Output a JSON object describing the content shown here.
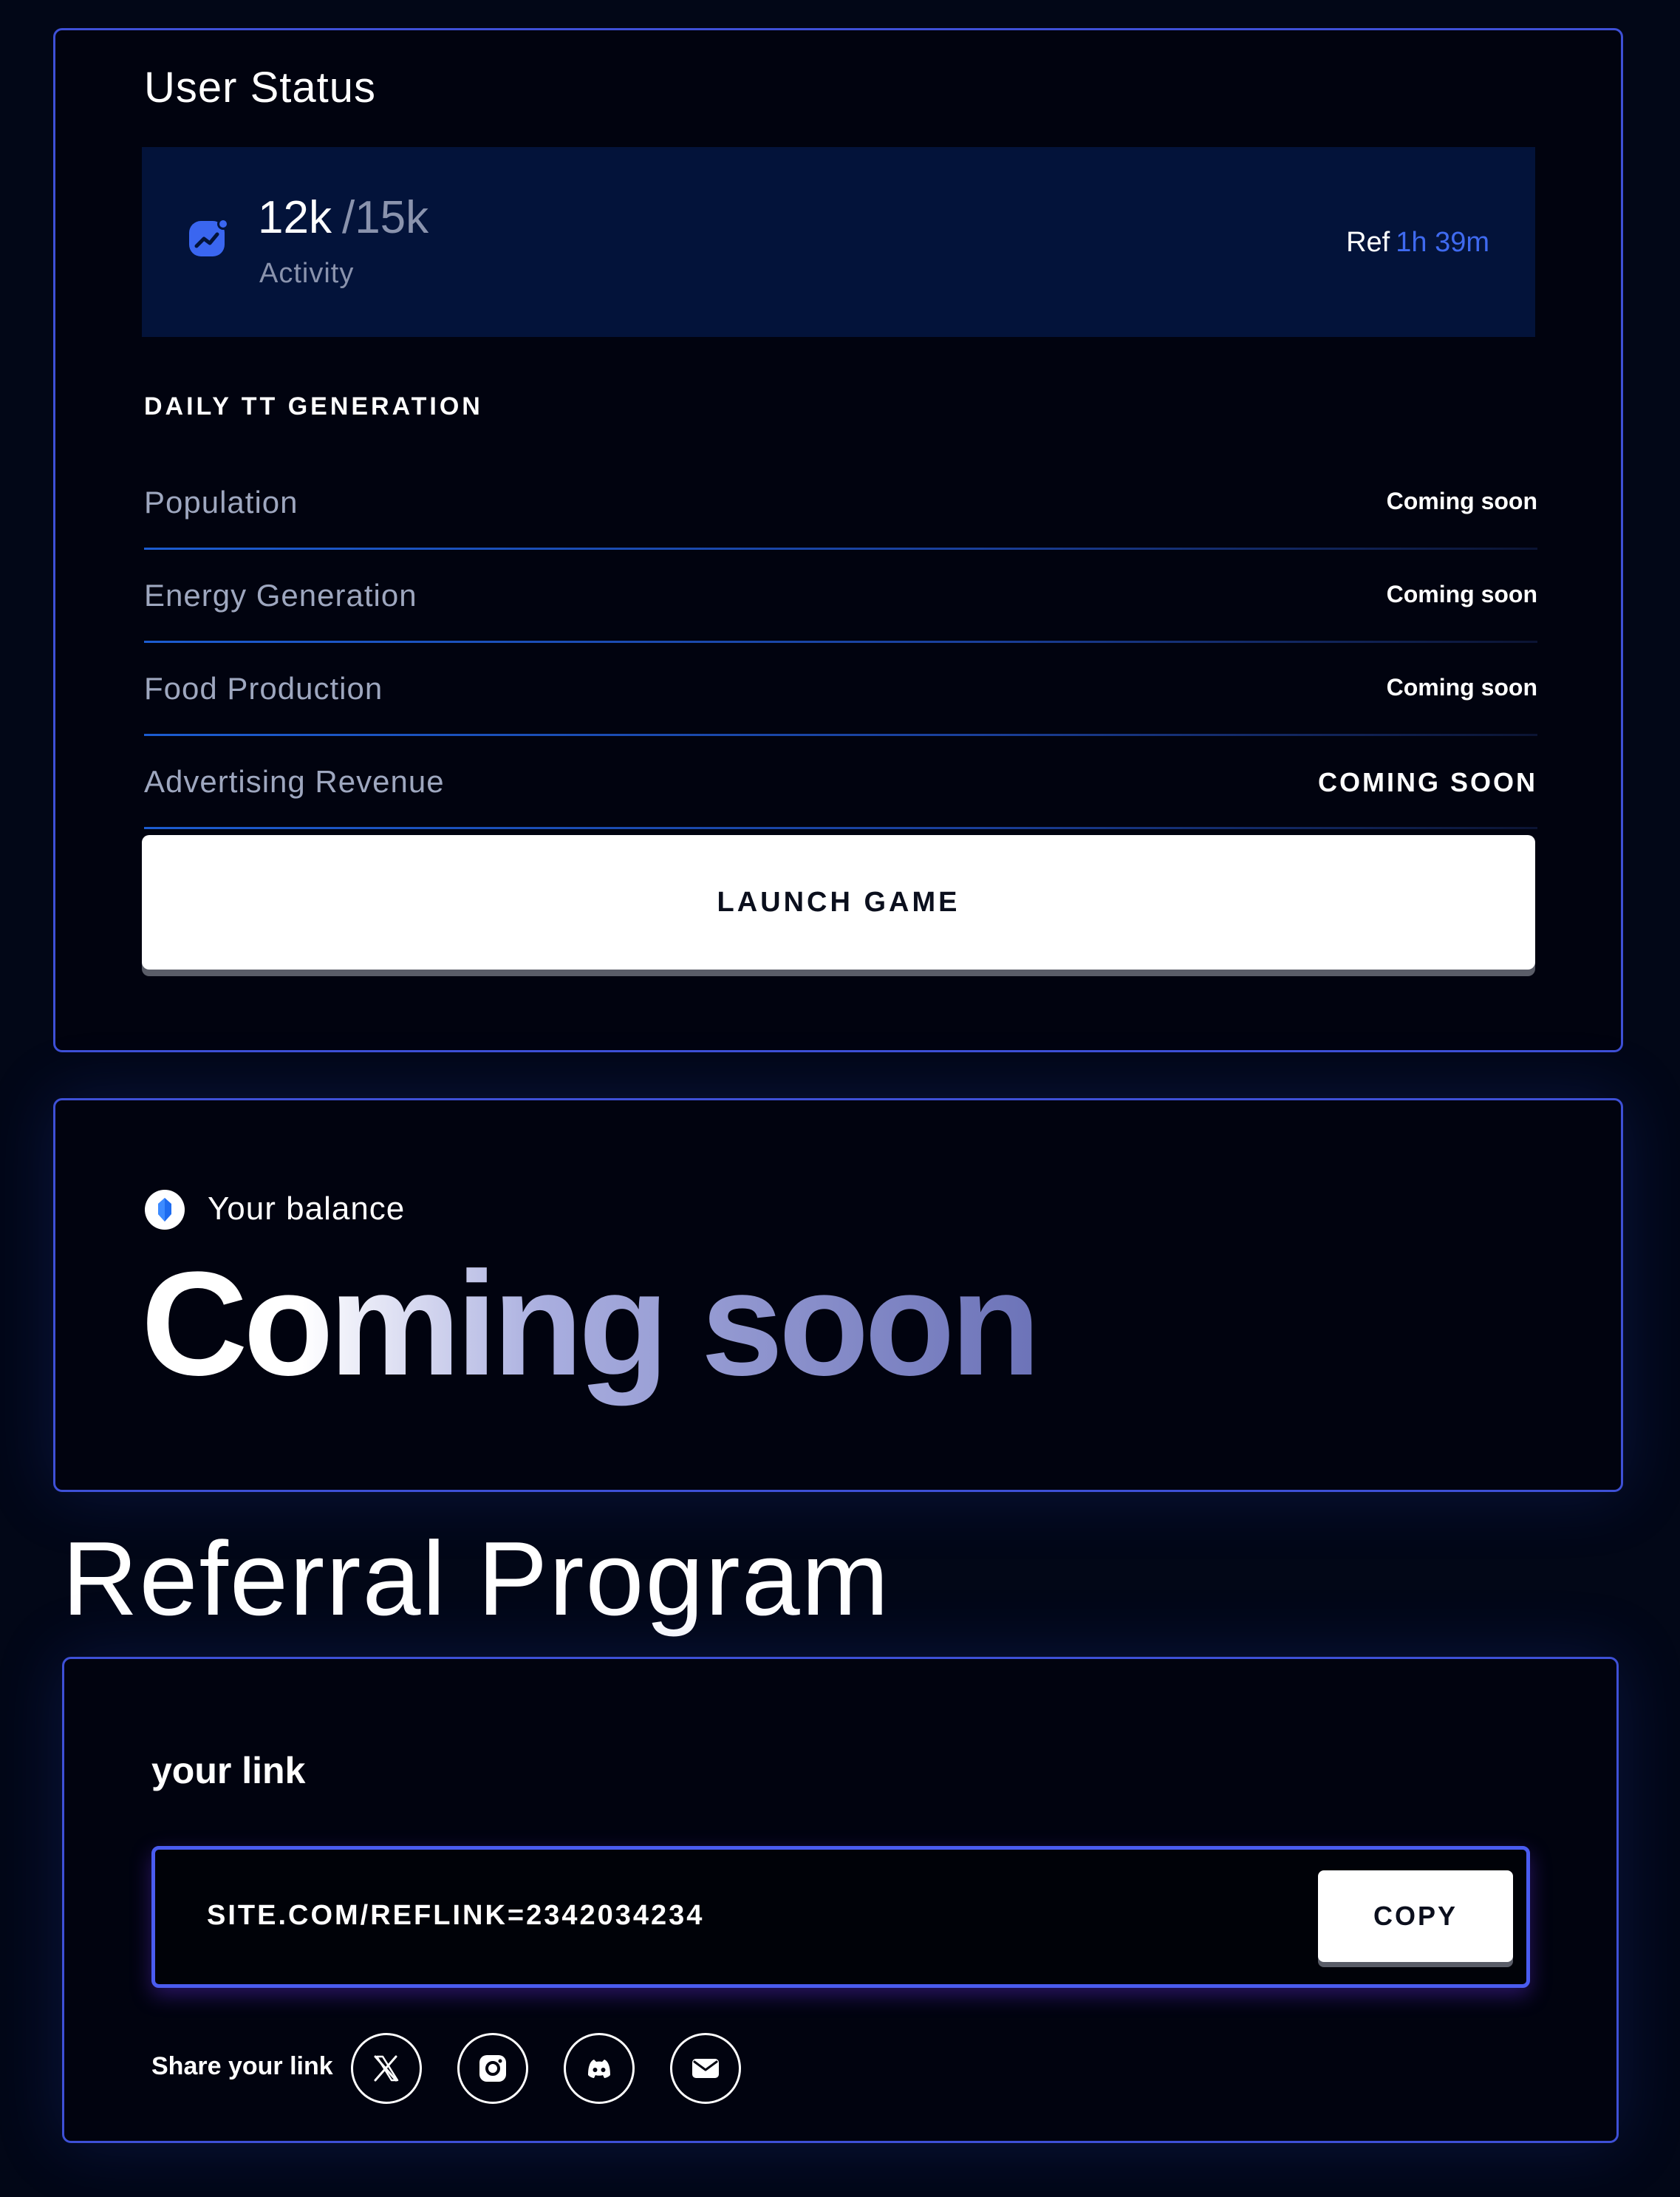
{
  "user_status": {
    "title": "User Status",
    "activity": {
      "current": "12k",
      "max": "/15k",
      "label": "Activity",
      "ref_label": "Ref",
      "ref_time": "1h 39m",
      "icon": "activity-chart-icon"
    },
    "daily_generation": {
      "heading": "DAILY TT GENERATION",
      "rows": [
        {
          "label": "Population",
          "value": "Coming soon"
        },
        {
          "label": "Energy Generation",
          "value": "Coming soon"
        },
        {
          "label": "Food Production",
          "value": "Coming soon"
        },
        {
          "label": "Advertising Revenue",
          "value": "COMING SOON"
        }
      ]
    },
    "launch_label": "LAUNCH GAME"
  },
  "balance": {
    "label": "Your balance",
    "value": "Coming soon",
    "icon": "token-icon"
  },
  "referral": {
    "title": "Referral Program",
    "your_link_label": "your link",
    "link": "SITE.COM/REFLINK=2342034234",
    "copy_label": "COPY",
    "share_label": "Share your link",
    "social_icons": [
      "x-icon",
      "instagram-icon",
      "discord-icon",
      "email-icon"
    ]
  },
  "colors": {
    "background": "#020717",
    "panel_border": "#3e50d6",
    "accent_blue": "#3f6af0",
    "activity_box": "#03133a"
  }
}
